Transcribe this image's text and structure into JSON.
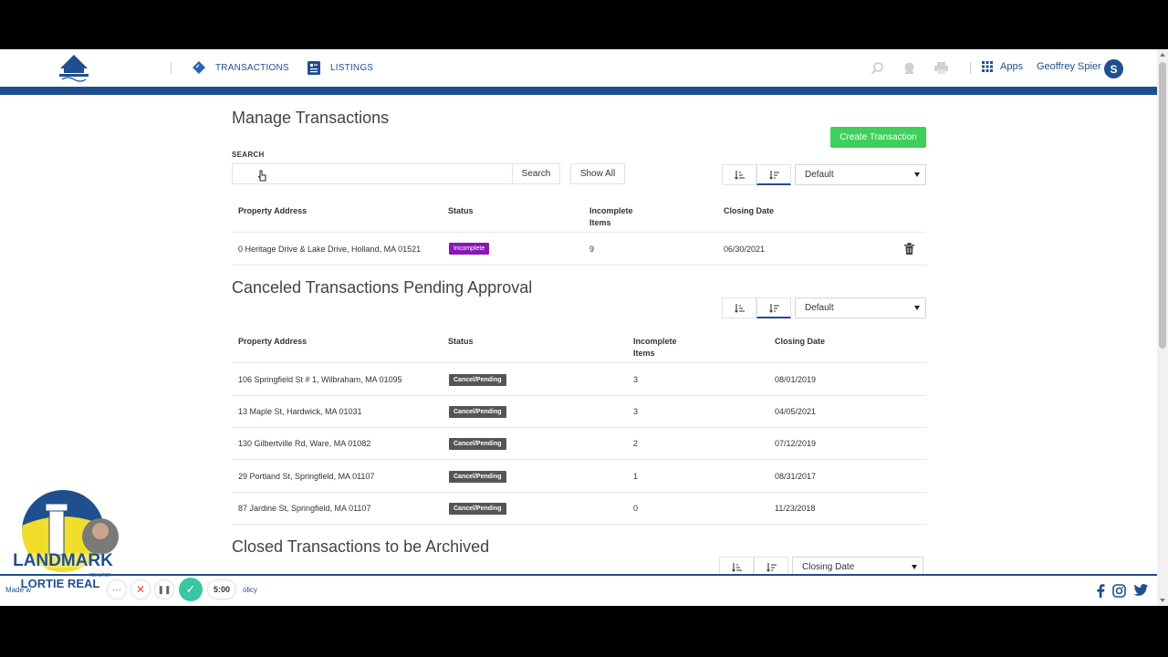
{
  "nav": {
    "transactions_label": "TRANSACTIONS",
    "listings_label": "LISTINGS",
    "apps_label": "Apps",
    "user_name": "Geoffrey Spier",
    "avatar_initial": "S"
  },
  "manage": {
    "title": "Manage Transactions",
    "search_label": "SEARCH",
    "search_value": "",
    "search_button": "Search",
    "show_all_button": "Show All",
    "create_button": "Create Transaction",
    "sort_select": "Default",
    "headers": {
      "address": "Property Address",
      "status": "Status",
      "incomplete_1": "Incomplete",
      "incomplete_2": "Items",
      "closing": "Closing Date"
    },
    "rows": [
      {
        "address": "0 Heritage Drive & Lake Drive, Holland, MA 01521",
        "status": "Incomplete",
        "incomplete": "9",
        "closing": "06/30/2021"
      }
    ]
  },
  "canceled": {
    "title": "Canceled Transactions Pending Approval",
    "sort_select": "Default",
    "headers": {
      "address": "Property Address",
      "status": "Status",
      "incomplete_1": "Incomplete",
      "incomplete_2": "Items",
      "closing": "Closing Date"
    },
    "rows": [
      {
        "address": "106 Springfield St # 1, Wilbraham, MA 01095",
        "status": "Cancel/Pending",
        "incomplete": "3",
        "closing": "08/01/2019"
      },
      {
        "address": "13 Maple St, Hardwick, MA 01031",
        "status": "Cancel/Pending",
        "incomplete": "3",
        "closing": "04/05/2021"
      },
      {
        "address": "130 Gilbertville Rd, Ware, MA 01082",
        "status": "Cancel/Pending",
        "incomplete": "2",
        "closing": "07/12/2019"
      },
      {
        "address": "29 Portland St, Springfield, MA 01107",
        "status": "Cancel/Pending",
        "incomplete": "1",
        "closing": "08/31/2017"
      },
      {
        "address": "87 Jardine St, Springfield, MA 01107",
        "status": "Cancel/Pending",
        "incomplete": "0",
        "closing": "11/23/2018"
      }
    ]
  },
  "closed": {
    "title": "Closed Transactions to be Archived",
    "sort_select": "Closing Date"
  },
  "footer": {
    "made_text": "Made w",
    "policy_text": "olicy"
  },
  "overlay": {
    "logo_text": "LANDMARK",
    "logo_sub": "LORTIE REAL",
    "realtor": "REALTOR",
    "timer": "5:00",
    "dots": "···",
    "close": "✕",
    "pause": "❚❚",
    "check": "✓"
  },
  "colors": {
    "brand_blue": "#1f4f8f",
    "create_green": "#3fd05b",
    "incomplete_purple": "#8a16b6",
    "cancel_grey": "#555555"
  }
}
